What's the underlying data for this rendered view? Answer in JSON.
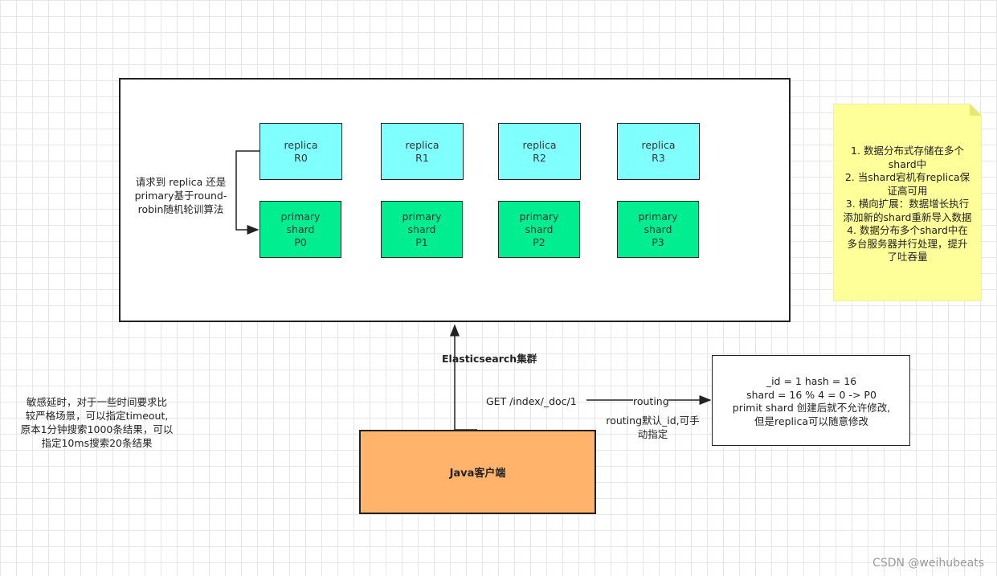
{
  "cluster": {
    "title": "Elasticsearch集群",
    "routing_note": [
      "请求到 replica 还是",
      "primary基于round-",
      "robin随机轮训算法"
    ],
    "replicas": [
      {
        "l1": "replica",
        "l2": "R0"
      },
      {
        "l1": "replica",
        "l2": "R1"
      },
      {
        "l1": "replica",
        "l2": "R2"
      },
      {
        "l1": "replica",
        "l2": "R3"
      }
    ],
    "primaries": [
      {
        "l1": "primary",
        "l2": "shard",
        "l3": "P0"
      },
      {
        "l1": "primary",
        "l2": "shard",
        "l3": "P1"
      },
      {
        "l1": "primary",
        "l2": "shard",
        "l3": "P2"
      },
      {
        "l1": "primary",
        "l2": "shard",
        "l3": "P3"
      }
    ]
  },
  "note": {
    "lines": [
      "1. 数据分布式存储在多个",
      "shard中",
      "2. 当shard宕机有replica保",
      "证高可用",
      "3. 横向扩展：数据增长执行",
      "添加新的shard重新导入数据",
      "4. 数据分布多个shard中在",
      "多台服务器并行处理，提升",
      "了吐吞量"
    ]
  },
  "client": {
    "label": "Java客户端"
  },
  "request": {
    "get": "GET /index/_doc/1",
    "routing": "routing",
    "routing_note": [
      "routing默认_id,可手",
      "动指定"
    ]
  },
  "hash": {
    "lines": [
      "_id = 1 hash = 16",
      "shard = 16 % 4 = 0 -> P0",
      "primit shard 创建后就不允许修改,",
      "但是replica可以随意修改"
    ]
  },
  "latency_note": {
    "lines": [
      "敏感延时，对于一些时间要求比",
      "较严格场景，可以指定timeout,",
      "原本1分钟搜索1000条结果，可以",
      "指定10ms搜索20条结果"
    ]
  },
  "watermark": "CSDN @weihubeats",
  "colors": {
    "replica": "#80ffff",
    "primary": "#00ee90",
    "client": "#ffb36b",
    "note": "#ffff99"
  }
}
